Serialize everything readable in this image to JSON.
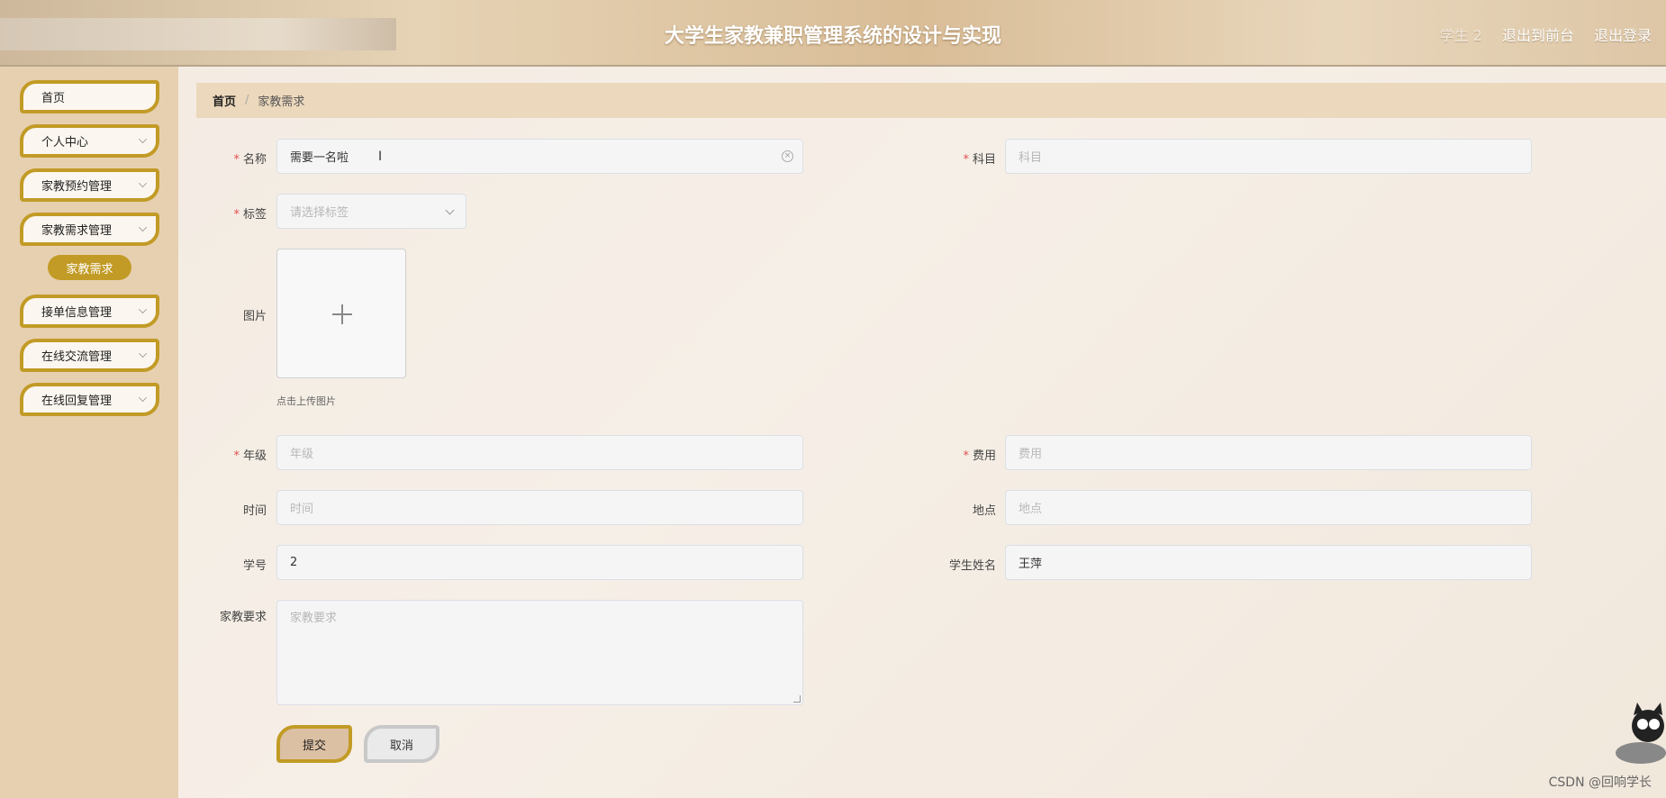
{
  "header": {
    "title": "大学生家教兼职管理系统的设计与实现",
    "user": "学生 2",
    "to_front": "退出到前台",
    "logout": "退出登录"
  },
  "sidebar": {
    "items": [
      {
        "label": "首页"
      },
      {
        "label": "个人中心"
      },
      {
        "label": "家教预约管理"
      },
      {
        "label": "家教需求管理"
      },
      {
        "label": "接单信息管理"
      },
      {
        "label": "在线交流管理"
      },
      {
        "label": "在线回复管理"
      }
    ],
    "sub_active": "家教需求"
  },
  "breadcrumb": {
    "home": "首页",
    "separator": "/",
    "current": "家教需求"
  },
  "form": {
    "name_label": "名称",
    "name_value": "需要一名啦",
    "subject_label": "科目",
    "subject_placeholder": "科目",
    "tag_label": "标签",
    "tag_placeholder": "请选择标签",
    "image_label": "图片",
    "upload_hint": "点击上传图片",
    "grade_label": "年级",
    "grade_placeholder": "年级",
    "fee_label": "费用",
    "fee_placeholder": "费用",
    "time_label": "时间",
    "time_placeholder": "时间",
    "location_label": "地点",
    "location_placeholder": "地点",
    "student_id_label": "学号",
    "student_id_value": "2",
    "student_name_label": "学生姓名",
    "student_name_value": "王萍",
    "requirement_label": "家教要求",
    "requirement_placeholder": "家教要求",
    "required_mark": "*"
  },
  "buttons": {
    "submit": "提交",
    "cancel": "取消"
  },
  "watermark": "CSDN @回响学长"
}
